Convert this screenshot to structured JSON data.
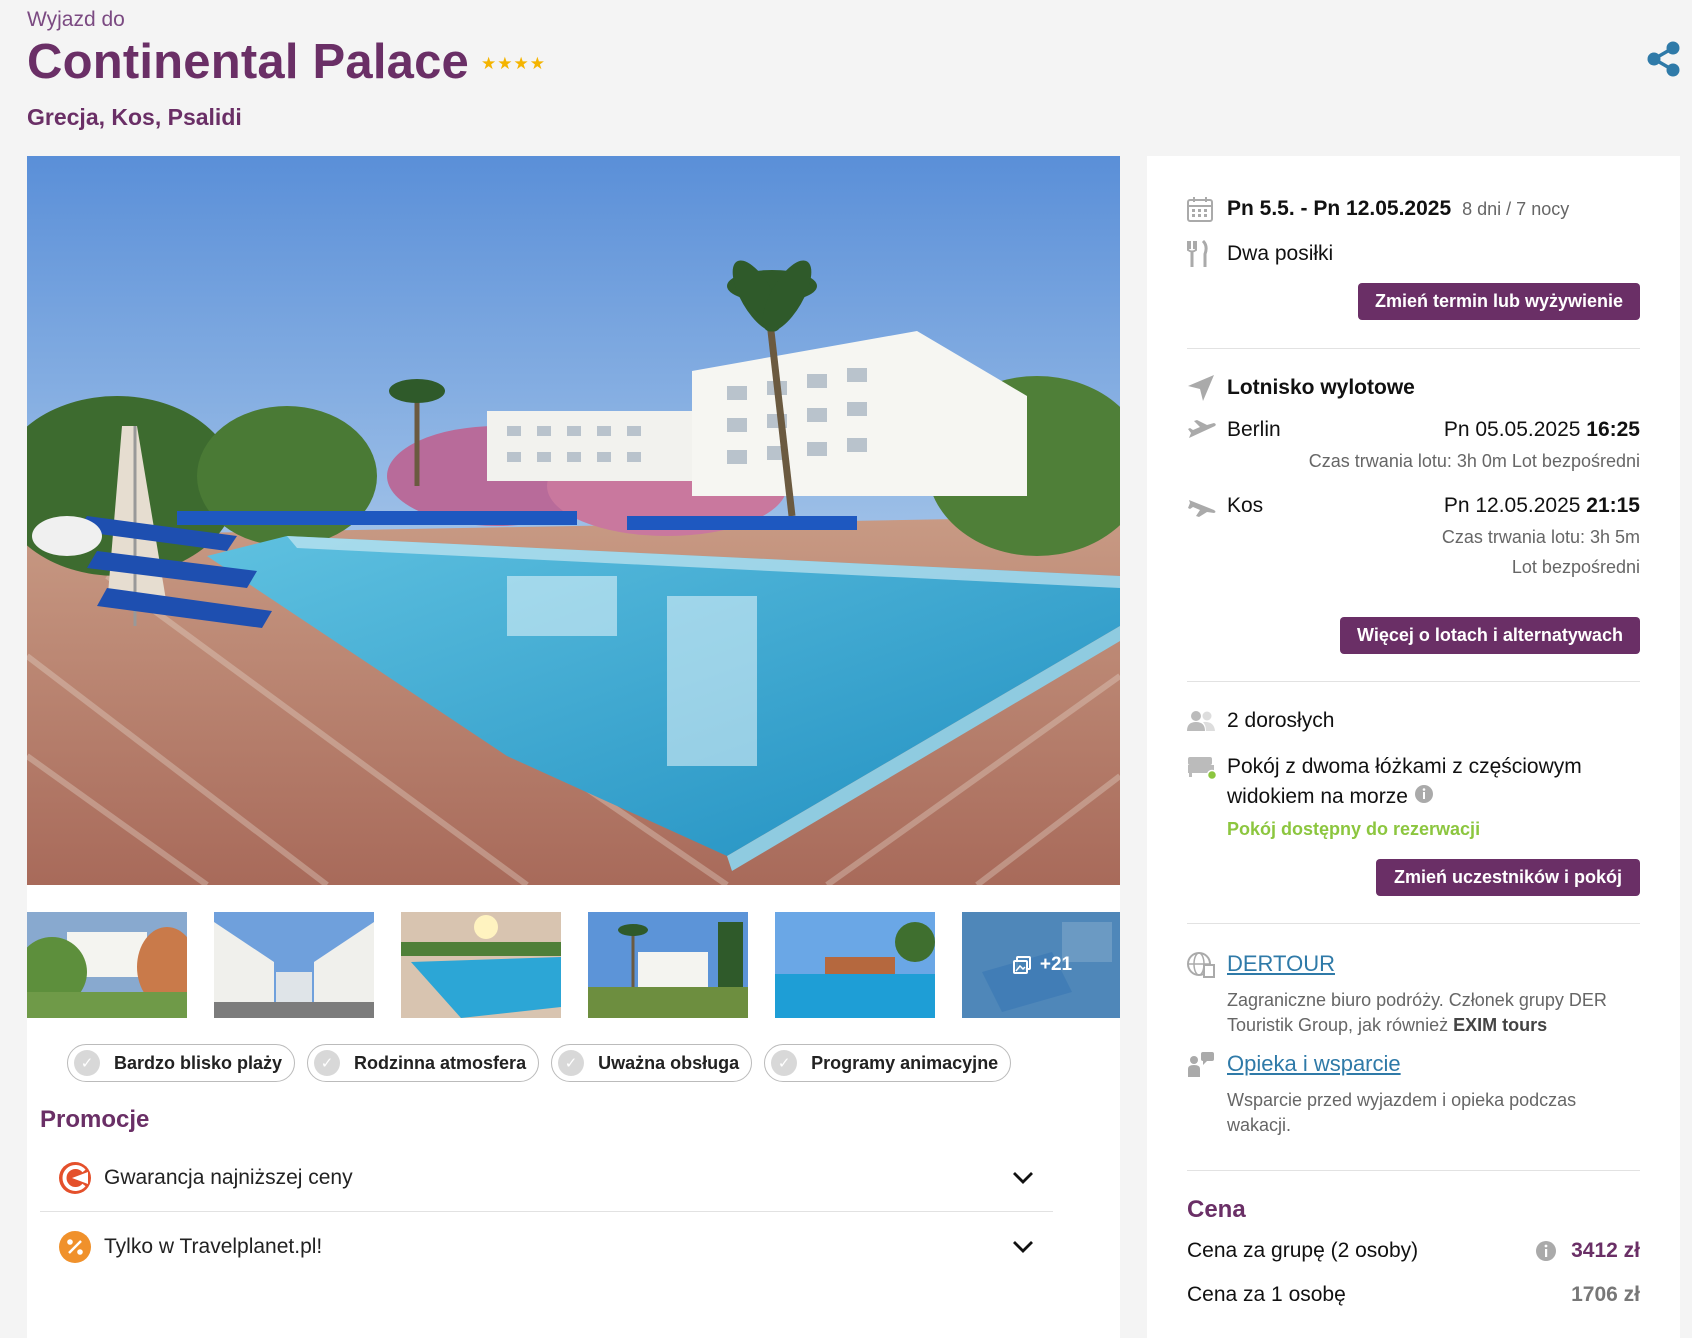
{
  "header": {
    "pre_title": "Wyjazd do",
    "title": "Continental Palace",
    "stars": 4,
    "location": "Grecja, Kos, Psalidi"
  },
  "gallery": {
    "more_count": "+21"
  },
  "tags": [
    "Bardzo blisko plaży",
    "Rodzinna atmosfera",
    "Uważna obsługa",
    "Programy animacyjne"
  ],
  "promotions": {
    "title": "Promocje",
    "items": [
      "Gwarancja najniższej ceny",
      "Tylko w Travelplanet.pl!"
    ]
  },
  "trip": {
    "dates": "Pn 5.5. - Pn 12.05.2025",
    "duration": "8 dni / 7 nocy",
    "board": "Dwa posiłki",
    "change_button": "Zmień termin lub wyżywienie"
  },
  "flights": {
    "title": "Lotnisko wylotowe",
    "outbound": {
      "city": "Berlin",
      "date": "Pn 05.05.2025",
      "time": "16:25",
      "duration": "Czas trwania lotu: 3h 0m",
      "type": "Lot bezpośredni"
    },
    "inbound": {
      "city": "Kos",
      "date": "Pn 12.05.2025",
      "time": "21:15",
      "duration": "Czas trwania lotu: 3h 5m",
      "type": "Lot bezpośredni"
    },
    "more_button": "Więcej o lotach i alternatywach"
  },
  "room": {
    "participants": "2 dorosłych",
    "room_type_line1": "Pokój z dwoma łóżkami z częściowym",
    "room_type_line2": "widokiem na morze",
    "availability": "Pokój dostępny do rezerwacji",
    "change_button": "Zmień uczestników i pokój"
  },
  "operator": {
    "name": "DERTOUR",
    "desc_line1": "Zagraniczne biuro podróży. Członek grupy DER",
    "desc_line2_pre": "Touristik Group, jak również ",
    "desc_line2_bold": "EXIM tours",
    "support_link": "Opieka i wsparcie",
    "support_line1": "Wsparcie przed wyjazdem i opieka podczas",
    "support_line2": "wakacji."
  },
  "price": {
    "title": "Cena",
    "group_label": "Cena za grupę (2 osoby)",
    "group_value": "3412 zł",
    "person_label": "Cena za 1 osobę",
    "person_value": "1706 zł"
  },
  "colors": {
    "brand": "#6a2f66",
    "link": "#2f7aa8",
    "available": "#8cc63f",
    "star": "#f4b400"
  }
}
